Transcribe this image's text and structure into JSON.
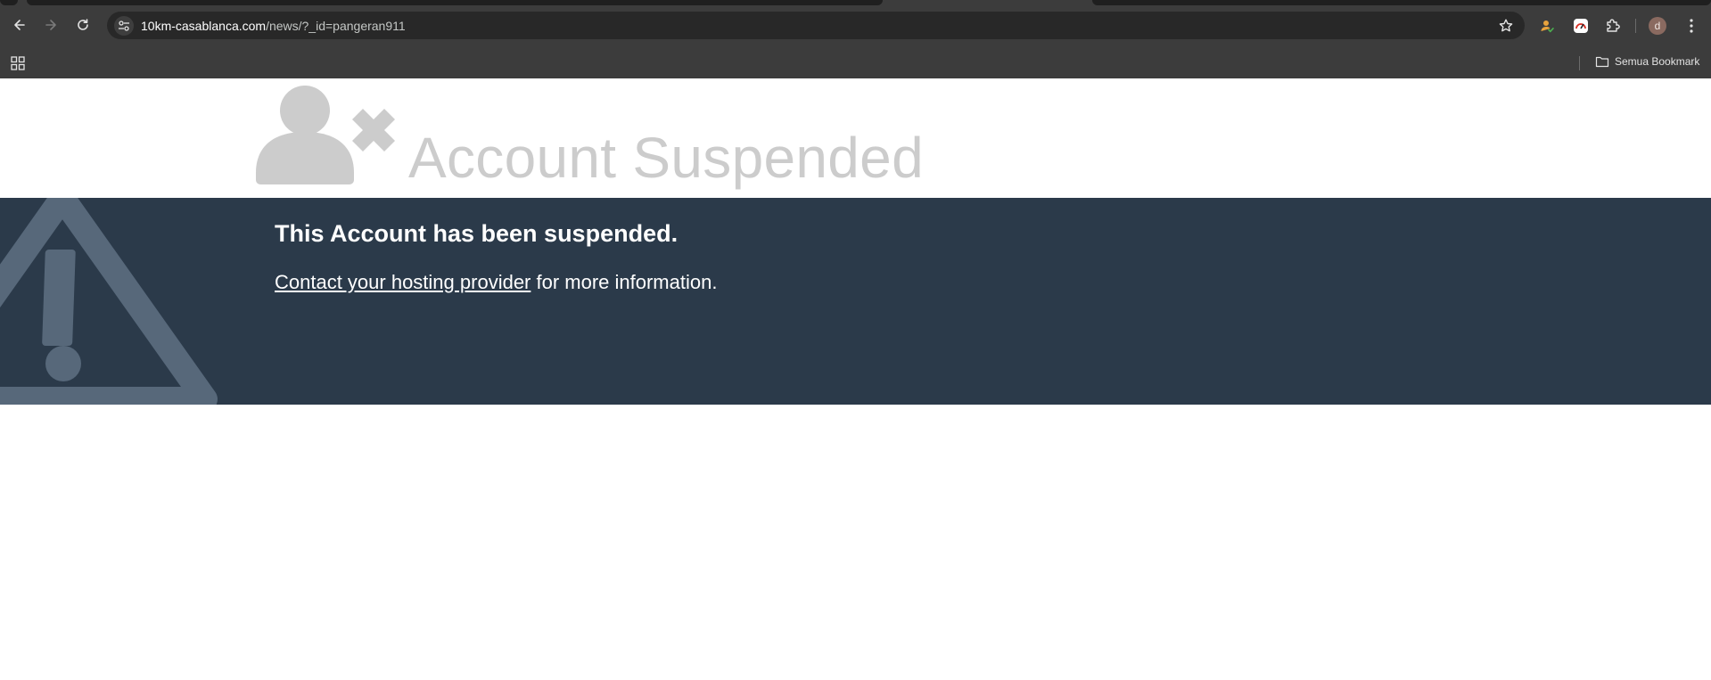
{
  "browser": {
    "url_host": "10km-casablanca.com",
    "url_path": "/news/?_id=pangeran911",
    "profile_initial": "d",
    "bookmarks_folder_label": "Semua Bookmark"
  },
  "page": {
    "title": "Account Suspended",
    "heading": "This Account has been suspended.",
    "contact_link": "Contact your hosting provider",
    "contact_suffix": " for more information.",
    "colors": {
      "banner": "#2b3a4a",
      "title": "#cccccc",
      "icon": "#cccccc",
      "warning": "#57687a"
    }
  },
  "icons": {
    "back": "arrow-left-icon",
    "forward": "arrow-right-icon",
    "reload": "reload-icon",
    "site_info": "tune-icon",
    "bookmark_star": "star-icon",
    "apps": "grid-icon",
    "folder": "folder-icon",
    "extensions": "puzzle-icon",
    "menu": "kebab-menu-icon",
    "user_x": "user-x-icon",
    "warning": "warning-triangle-icon"
  }
}
